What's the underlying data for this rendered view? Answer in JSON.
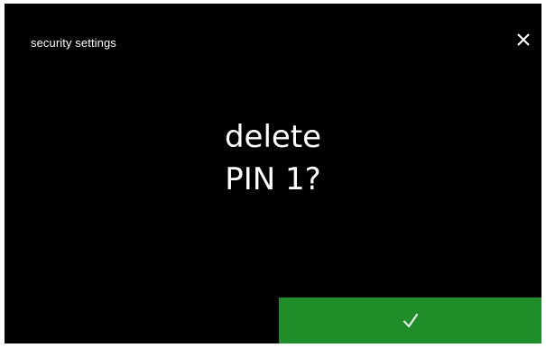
{
  "header": {
    "title": "security settings",
    "close_icon": "close-icon"
  },
  "prompt": {
    "line1": "delete",
    "line2": "PIN 1?"
  },
  "confirm": {
    "icon": "checkmark-icon"
  },
  "colors": {
    "background": "#000000",
    "frame": "#ffffff",
    "text": "#ffffff",
    "confirm_button": "#1f8e28"
  }
}
